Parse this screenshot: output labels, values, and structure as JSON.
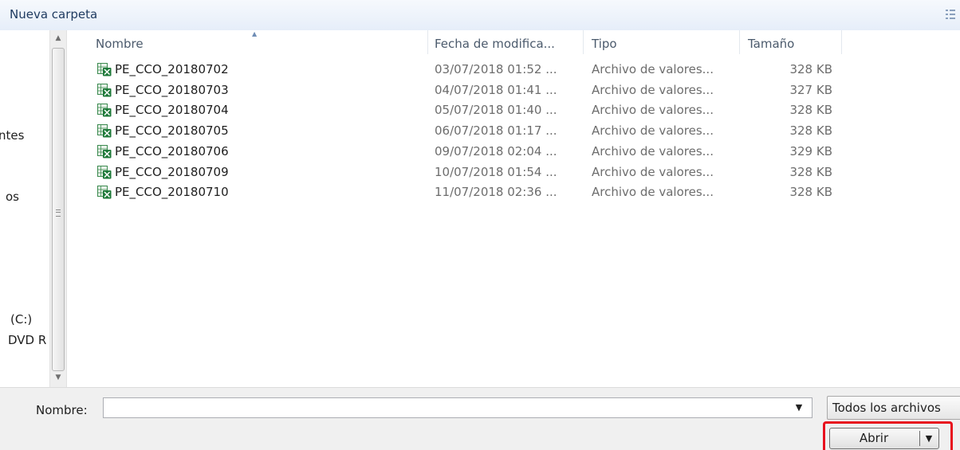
{
  "toolbar": {
    "new_folder_label": "Nueva carpeta",
    "view_icon": "view-options-icon"
  },
  "nav_pane": {
    "items": [
      "ntes",
      "os",
      "(C:)",
      "DVD R"
    ]
  },
  "file_list": {
    "columns": [
      "Nombre",
      "Fecha de modifica...",
      "Tipo",
      "Tamaño"
    ],
    "sorted_column": "Nombre",
    "file_icon": "excel-csv-file-icon",
    "rows": [
      {
        "name": "PE_CCO_20180702",
        "date": "03/07/2018 01:52 ...",
        "type": "Archivo de valores...",
        "size": "328 KB"
      },
      {
        "name": "PE_CCO_20180703",
        "date": "04/07/2018 01:41 ...",
        "type": "Archivo de valores...",
        "size": "327 KB"
      },
      {
        "name": "PE_CCO_20180704",
        "date": "05/07/2018 01:40 ...",
        "type": "Archivo de valores...",
        "size": "328 KB"
      },
      {
        "name": "PE_CCO_20180705",
        "date": "06/07/2018 01:17 ...",
        "type": "Archivo de valores...",
        "size": "328 KB"
      },
      {
        "name": "PE_CCO_20180706",
        "date": "09/07/2018 02:04 ...",
        "type": "Archivo de valores...",
        "size": "329 KB"
      },
      {
        "name": "PE_CCO_20180709",
        "date": "10/07/2018 01:54 ...",
        "type": "Archivo de valores...",
        "size": "328 KB"
      },
      {
        "name": "PE_CCO_20180710",
        "date": "11/07/2018 02:36 ...",
        "type": "Archivo de valores...",
        "size": "328 KB"
      }
    ]
  },
  "bottom_bar": {
    "name_label": "Nombre:",
    "name_value": "",
    "file_type_filter": "Todos los archivos",
    "open_button_label": "Abrir"
  },
  "colors": {
    "highlight": "#e8111e",
    "toolbar_bg": "#e6eef9",
    "excel_green": "#1f7a3a"
  }
}
